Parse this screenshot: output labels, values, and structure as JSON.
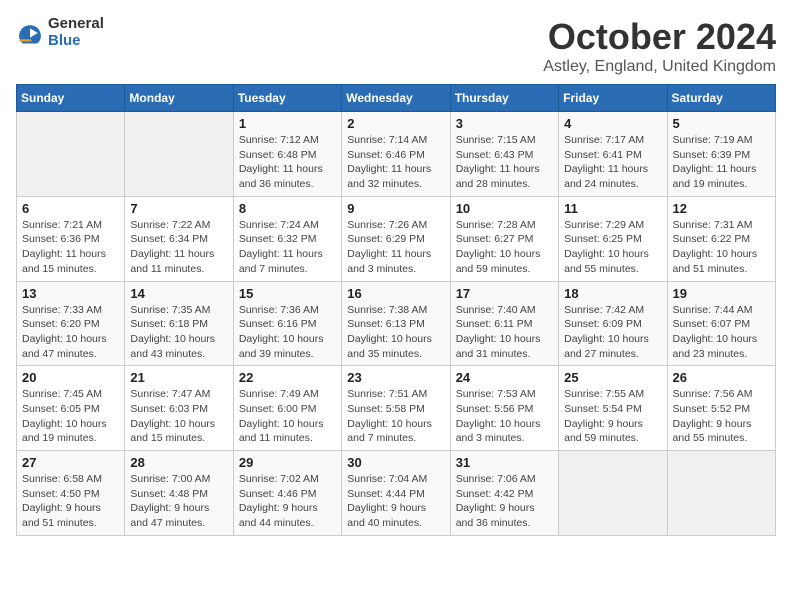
{
  "logo": {
    "general": "General",
    "blue": "Blue"
  },
  "title": "October 2024",
  "location": "Astley, England, United Kingdom",
  "days_of_week": [
    "Sunday",
    "Monday",
    "Tuesday",
    "Wednesday",
    "Thursday",
    "Friday",
    "Saturday"
  ],
  "weeks": [
    [
      {
        "day": "",
        "info": ""
      },
      {
        "day": "",
        "info": ""
      },
      {
        "day": "1",
        "info": "Sunrise: 7:12 AM\nSunset: 6:48 PM\nDaylight: 11 hours\nand 36 minutes."
      },
      {
        "day": "2",
        "info": "Sunrise: 7:14 AM\nSunset: 6:46 PM\nDaylight: 11 hours\nand 32 minutes."
      },
      {
        "day": "3",
        "info": "Sunrise: 7:15 AM\nSunset: 6:43 PM\nDaylight: 11 hours\nand 28 minutes."
      },
      {
        "day": "4",
        "info": "Sunrise: 7:17 AM\nSunset: 6:41 PM\nDaylight: 11 hours\nand 24 minutes."
      },
      {
        "day": "5",
        "info": "Sunrise: 7:19 AM\nSunset: 6:39 PM\nDaylight: 11 hours\nand 19 minutes."
      }
    ],
    [
      {
        "day": "6",
        "info": "Sunrise: 7:21 AM\nSunset: 6:36 PM\nDaylight: 11 hours\nand 15 minutes."
      },
      {
        "day": "7",
        "info": "Sunrise: 7:22 AM\nSunset: 6:34 PM\nDaylight: 11 hours\nand 11 minutes."
      },
      {
        "day": "8",
        "info": "Sunrise: 7:24 AM\nSunset: 6:32 PM\nDaylight: 11 hours\nand 7 minutes."
      },
      {
        "day": "9",
        "info": "Sunrise: 7:26 AM\nSunset: 6:29 PM\nDaylight: 11 hours\nand 3 minutes."
      },
      {
        "day": "10",
        "info": "Sunrise: 7:28 AM\nSunset: 6:27 PM\nDaylight: 10 hours\nand 59 minutes."
      },
      {
        "day": "11",
        "info": "Sunrise: 7:29 AM\nSunset: 6:25 PM\nDaylight: 10 hours\nand 55 minutes."
      },
      {
        "day": "12",
        "info": "Sunrise: 7:31 AM\nSunset: 6:22 PM\nDaylight: 10 hours\nand 51 minutes."
      }
    ],
    [
      {
        "day": "13",
        "info": "Sunrise: 7:33 AM\nSunset: 6:20 PM\nDaylight: 10 hours\nand 47 minutes."
      },
      {
        "day": "14",
        "info": "Sunrise: 7:35 AM\nSunset: 6:18 PM\nDaylight: 10 hours\nand 43 minutes."
      },
      {
        "day": "15",
        "info": "Sunrise: 7:36 AM\nSunset: 6:16 PM\nDaylight: 10 hours\nand 39 minutes."
      },
      {
        "day": "16",
        "info": "Sunrise: 7:38 AM\nSunset: 6:13 PM\nDaylight: 10 hours\nand 35 minutes."
      },
      {
        "day": "17",
        "info": "Sunrise: 7:40 AM\nSunset: 6:11 PM\nDaylight: 10 hours\nand 31 minutes."
      },
      {
        "day": "18",
        "info": "Sunrise: 7:42 AM\nSunset: 6:09 PM\nDaylight: 10 hours\nand 27 minutes."
      },
      {
        "day": "19",
        "info": "Sunrise: 7:44 AM\nSunset: 6:07 PM\nDaylight: 10 hours\nand 23 minutes."
      }
    ],
    [
      {
        "day": "20",
        "info": "Sunrise: 7:45 AM\nSunset: 6:05 PM\nDaylight: 10 hours\nand 19 minutes."
      },
      {
        "day": "21",
        "info": "Sunrise: 7:47 AM\nSunset: 6:03 PM\nDaylight: 10 hours\nand 15 minutes."
      },
      {
        "day": "22",
        "info": "Sunrise: 7:49 AM\nSunset: 6:00 PM\nDaylight: 10 hours\nand 11 minutes."
      },
      {
        "day": "23",
        "info": "Sunrise: 7:51 AM\nSunset: 5:58 PM\nDaylight: 10 hours\nand 7 minutes."
      },
      {
        "day": "24",
        "info": "Sunrise: 7:53 AM\nSunset: 5:56 PM\nDaylight: 10 hours\nand 3 minutes."
      },
      {
        "day": "25",
        "info": "Sunrise: 7:55 AM\nSunset: 5:54 PM\nDaylight: 9 hours\nand 59 minutes."
      },
      {
        "day": "26",
        "info": "Sunrise: 7:56 AM\nSunset: 5:52 PM\nDaylight: 9 hours\nand 55 minutes."
      }
    ],
    [
      {
        "day": "27",
        "info": "Sunrise: 6:58 AM\nSunset: 4:50 PM\nDaylight: 9 hours\nand 51 minutes."
      },
      {
        "day": "28",
        "info": "Sunrise: 7:00 AM\nSunset: 4:48 PM\nDaylight: 9 hours\nand 47 minutes."
      },
      {
        "day": "29",
        "info": "Sunrise: 7:02 AM\nSunset: 4:46 PM\nDaylight: 9 hours\nand 44 minutes."
      },
      {
        "day": "30",
        "info": "Sunrise: 7:04 AM\nSunset: 4:44 PM\nDaylight: 9 hours\nand 40 minutes."
      },
      {
        "day": "31",
        "info": "Sunrise: 7:06 AM\nSunset: 4:42 PM\nDaylight: 9 hours\nand 36 minutes."
      },
      {
        "day": "",
        "info": ""
      },
      {
        "day": "",
        "info": ""
      }
    ]
  ]
}
